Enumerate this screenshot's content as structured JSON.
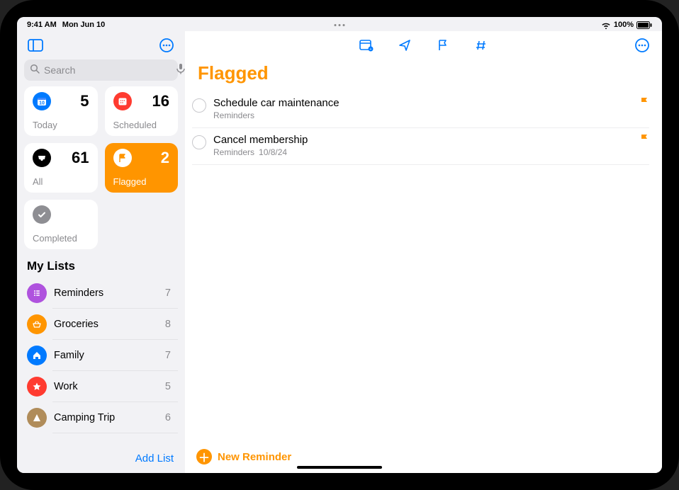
{
  "status": {
    "time": "9:41 AM",
    "date": "Mon Jun 10",
    "battery": "100%"
  },
  "sidebar": {
    "search_placeholder": "Search",
    "smart": [
      {
        "key": "today",
        "label": "Today",
        "count": "5",
        "bg": "#007aff"
      },
      {
        "key": "scheduled",
        "label": "Scheduled",
        "count": "16",
        "bg": "#ff3b30"
      },
      {
        "key": "all",
        "label": "All",
        "count": "61",
        "bg": "#000000"
      },
      {
        "key": "flagged",
        "label": "Flagged",
        "count": "2",
        "bg": "#ffffff",
        "active": true
      },
      {
        "key": "completed",
        "label": "Completed",
        "count": "",
        "bg": "#8e8e93",
        "wide": true
      }
    ],
    "section_title": "My Lists",
    "lists": [
      {
        "label": "Reminders",
        "count": "7",
        "bg": "#af52de",
        "icon": "list"
      },
      {
        "label": "Groceries",
        "count": "8",
        "bg": "#ff9500",
        "icon": "basket"
      },
      {
        "label": "Family",
        "count": "7",
        "bg": "#007aff",
        "icon": "house"
      },
      {
        "label": "Work",
        "count": "5",
        "bg": "#ff3b30",
        "icon": "star"
      },
      {
        "label": "Camping Trip",
        "count": "6",
        "bg": "#b08c5a",
        "icon": "tent"
      }
    ],
    "add_list_label": "Add List"
  },
  "main": {
    "title": "Flagged",
    "reminders": [
      {
        "title": "Schedule car maintenance",
        "sublist": "Reminders",
        "subdate": ""
      },
      {
        "title": "Cancel membership",
        "sublist": "Reminders",
        "subdate": "10/8/24"
      }
    ],
    "new_reminder_label": "New Reminder"
  }
}
